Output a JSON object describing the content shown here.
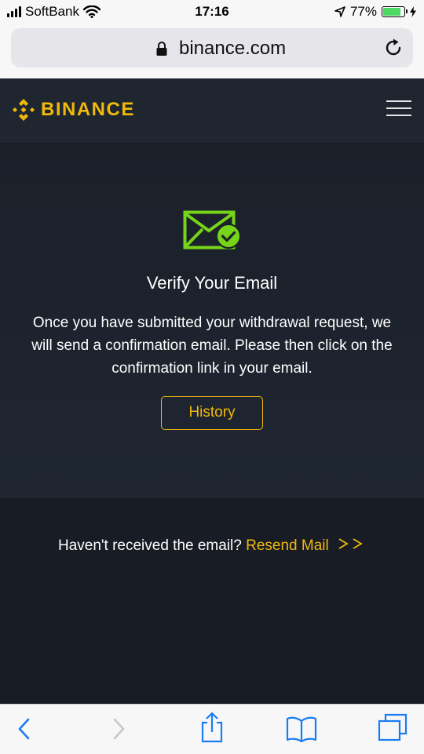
{
  "status_bar": {
    "carrier": "SoftBank",
    "time": "17:16",
    "battery_percent": "77%",
    "battery_level": 0.77,
    "icons": [
      "signal-icon",
      "wifi-icon",
      "location-arrow-icon",
      "battery-icon"
    ]
  },
  "browser": {
    "url": "binance.com",
    "icons": [
      "lock-icon",
      "reload-icon"
    ]
  },
  "header": {
    "logo_text": "BINANCE",
    "brand_color": "#f0b90b",
    "icons": [
      "binance-logo-icon",
      "hamburger-menu-icon"
    ]
  },
  "verify": {
    "icon": "email-verified-icon",
    "icon_color": "#76d41a",
    "title": "Verify Your Email",
    "description": "Once you have submitted your withdrawal request, we will send a confirmation email. Please then click on the confirmation link in your email.",
    "history_button": "History"
  },
  "resend": {
    "prompt": "Haven't received the email?",
    "link": "Resend Mail",
    "arrows": ">>"
  },
  "toolbar": {
    "icons": [
      "back-icon",
      "forward-icon",
      "share-icon",
      "bookmarks-icon",
      "tabs-icon"
    ]
  },
  "colors": {
    "page_background": "#1f2632",
    "accent": "#f0b90b",
    "ios_blue": "#1a7cf5"
  }
}
